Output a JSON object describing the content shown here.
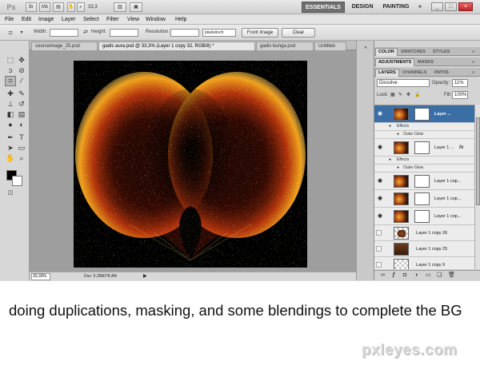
{
  "titlebar": {
    "logo": "Ps",
    "br_label": "Br",
    "mb_label": "Mb",
    "zoom": "33,3",
    "workspaces": [
      "ESSENTIALS",
      "DESIGN",
      "PAINTING"
    ],
    "more": "»"
  },
  "menu": [
    "File",
    "Edit",
    "Image",
    "Layer",
    "Select",
    "Filter",
    "View",
    "Window",
    "Help"
  ],
  "options": {
    "width_label": "Width:",
    "height_label": "Height:",
    "resolution_label": "Resolution:",
    "units_value": "pixels/inch",
    "front_image_label": "Front Image",
    "clear_label": "Clear"
  },
  "doc_tabs": [
    "sourceimage_25.psd",
    "gadis aura.psd @ 33,3% (Layer 1 copy 32, RGB/8) *",
    "gadis bunga.psd",
    "Untitled-"
  ],
  "status": {
    "zoom": "33,33%",
    "doc": "Doc: 5,39M/78,4M"
  },
  "panels": {
    "row1_tabs": [
      "COLOR",
      "SWATCHES",
      "STYLES"
    ],
    "row2_tabs": [
      "ADJUSTMENTS",
      "MASKS"
    ],
    "row3_tabs": [
      "LAYERS",
      "CHANNELS",
      "PATHS"
    ],
    "blend_mode": "Dissolve",
    "opacity_label": "Opacity:",
    "opacity_value": "11%",
    "lock_label": "Lock:",
    "fill_label": "Fill:",
    "fill_value": "100%"
  },
  "layers": [
    {
      "name": "Layer ...",
      "selected": true
    },
    {
      "name": "Layer 1 ...",
      "fx": true
    },
    {
      "name": "Layer 1 cop..."
    },
    {
      "name": "Layer 1 cop..."
    },
    {
      "name": "Layer 1 cop..."
    },
    {
      "name": "Layer 1 copy 26"
    },
    {
      "name": "Layer 1 copy 25"
    },
    {
      "name": "Layer 1 copy 9"
    }
  ],
  "effects": {
    "effects_label": "Effects",
    "outer_glow_label": "Outer Glow",
    "fx_mark": "fx"
  },
  "caption": "doing duplications, masking, and some blendings to complete the BG",
  "watermark": "pxleyes.com"
}
